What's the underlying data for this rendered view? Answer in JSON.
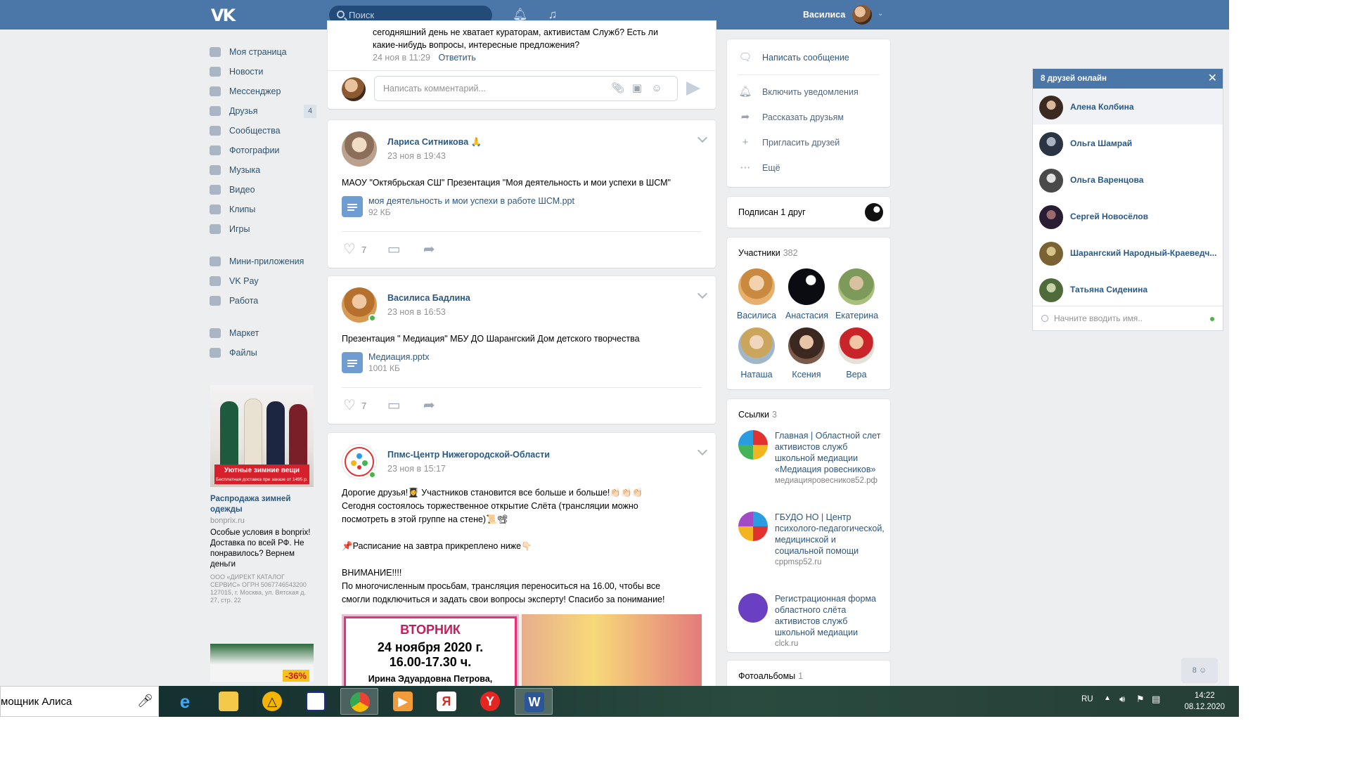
{
  "header": {
    "logo": "VK",
    "search_placeholder": "Поиск",
    "user_name": "Василиса"
  },
  "nav": {
    "items": [
      {
        "label": "Моя страница",
        "icon": "home-icon"
      },
      {
        "label": "Новости",
        "icon": "news-icon"
      },
      {
        "label": "Мессенджер",
        "icon": "messenger-icon"
      },
      {
        "label": "Друзья",
        "icon": "friends-icon",
        "count": "4"
      },
      {
        "label": "Сообщества",
        "icon": "communities-icon"
      },
      {
        "label": "Фотографии",
        "icon": "camera-icon"
      },
      {
        "label": "Музыка",
        "icon": "music-icon"
      },
      {
        "label": "Видео",
        "icon": "video-icon"
      },
      {
        "label": "Клипы",
        "icon": "clips-icon"
      },
      {
        "label": "Игры",
        "icon": "gamepad-icon"
      }
    ],
    "items2": [
      {
        "label": "Мини-приложения",
        "icon": "apps-icon"
      },
      {
        "label": "VK Pay",
        "icon": "vkpay-icon"
      },
      {
        "label": "Работа",
        "icon": "briefcase-icon"
      }
    ],
    "items3": [
      {
        "label": "Маркет",
        "icon": "market-icon"
      },
      {
        "label": "Файлы",
        "icon": "file-icon"
      }
    ]
  },
  "ad": {
    "banner_title": "Уютные зимние вещи",
    "banner_sub": "Бесплатная доставка при заказе от 1495 р.",
    "title": "Распродажа зимней одежды",
    "domain": "bonprix.ru",
    "text": "Особые условия в bonprix! Доставка по всей РФ. Не понравилось? Вернем деньги",
    "legal": "ООО «ДИРЕКТ КАТАЛОГ СЕРВИС» ОГРН 5067746543200 127015, г. Москва, ул. Вятская д. 27, стр. 22",
    "ad2_discount": "-36%"
  },
  "comment_post": {
    "text_line1": "сегодняшний день не хватает кураторам, активистам Служб? Есть ли",
    "text_line2": "какие-нибудь вопросы, интересные предложения?",
    "date": "24 ноя в 11:29",
    "reply": "Ответить",
    "comment_placeholder": "Написать комментарий..."
  },
  "posts": [
    {
      "author": "Лариса Ситникова 🙏",
      "date": "23 ноя в 19:43",
      "text": "МАОУ \"Октябрьская СШ\" Презентация \"Моя деятельность и мои успехи в ШСМ\"",
      "doc_name": "моя деятельность и мои успехи в работе ШСМ.ppt",
      "doc_size": "92 КБ",
      "likes": "7"
    },
    {
      "author": "Василиса Бадлина",
      "date": "23 ноя в 16:53",
      "text": "Презентация \" Медиация\" МБУ ДО Шарангский Дом детского творчества",
      "doc_name": "Медиация.pptx",
      "doc_size": "1001 КБ",
      "likes": "7"
    },
    {
      "author": "Ппмс-Центр Нижегородской-Области",
      "date": "23 ноя в 15:17",
      "lines": [
        "Дорогие друзья!👩‍🎓 Участников становится все больше и больше!👏🏻👏🏻👏🏻",
        "Сегодня состоялось торжественное открытие Слёта (трансляции можно",
        "посмотреть в этой группе на стене)📜📽",
        "",
        "📌Расписание на завтра прикреплено ниже👇🏻",
        "",
        "ВНИМАНИЕ!!!!",
        "По многочисленным просьбам, трансляция переноситься на 16.00, чтобы все",
        "смогли подключиться и задать свои вопросы эксперту! Спасибо за понимание!"
      ],
      "img_day": "ВТОРНИК",
      "img_date": "24 ноября 2020 г.",
      "img_time": "16.00-17.30 ч.",
      "img_name": "Ирина Эдуардовна Петрова,"
    }
  ],
  "side_actions": {
    "write": "Написать сообщение",
    "notify": "Включить уведомления",
    "tell": "Рассказать друзьям",
    "invite": "Пригласить друзей",
    "more": "Ещё"
  },
  "subscribed": "Подписан 1 друг",
  "members": {
    "title": "Участники",
    "count": "382",
    "list": [
      "Василиса",
      "Анастасия",
      "Екатерина",
      "Наташа",
      "Ксения",
      "Вера"
    ]
  },
  "links": {
    "title": "Ссылки",
    "count": "3",
    "list": [
      {
        "title": "Главная | Областной слет активистов служб школьной медиации «Медиация ровесников»",
        "domain": "медиацияровесников52.рф"
      },
      {
        "title": "ГБУДО НО | Центр психолого-педагогической, медицинской и социальной помощи",
        "domain": "cppmsp52.ru"
      },
      {
        "title": "Регистрационная форма областного слёта активистов служб школьной медиации",
        "domain": "clck.ru"
      }
    ]
  },
  "albums": {
    "title": "Фотоальбомы",
    "count": "1"
  },
  "chat": {
    "title": "8 друзей онлайн",
    "friends": [
      "Алена Колбина",
      "Ольга Шамрай",
      "Ольга Варенцова",
      "Сергей Новосёлов",
      "Шарангский Народный-Краеведч...",
      "Татьяна Сиденина"
    ],
    "search_placeholder": "Начните вводить имя.."
  },
  "friends_button": "8",
  "taskbar": {
    "alisa": "мощник Алиса",
    "lang": "RU",
    "time": "14:22",
    "date": "08.12.2020"
  },
  "colors": {
    "brand": "#4a76a8",
    "link": "#2a5885",
    "online": "#4bb34b"
  }
}
